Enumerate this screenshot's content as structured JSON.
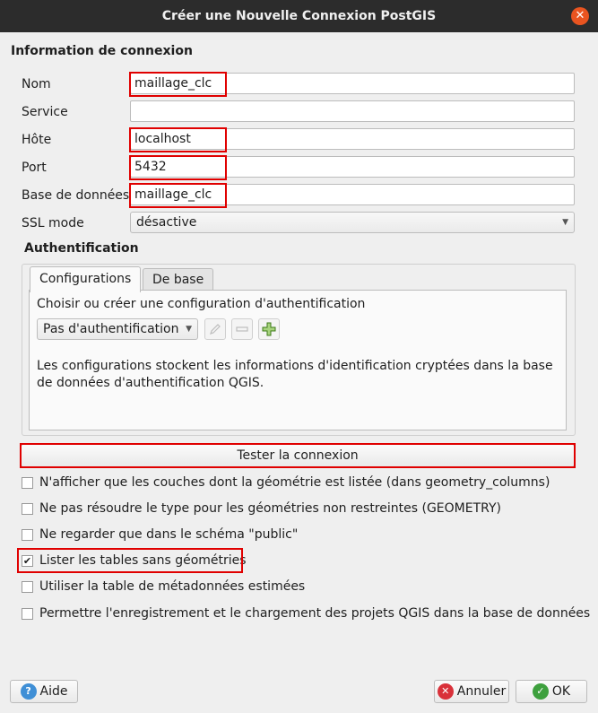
{
  "window": {
    "title": "Créer une Nouvelle Connexion PostGIS"
  },
  "connection_info": {
    "section_title": "Information de connexion",
    "fields": {
      "name": {
        "label": "Nom",
        "value": "maillage_clc"
      },
      "service": {
        "label": "Service",
        "value": ""
      },
      "host": {
        "label": "Hôte",
        "value": "localhost"
      },
      "port": {
        "label": "Port",
        "value": "5432"
      },
      "database": {
        "label": "Base de données",
        "value": "maillage_clc"
      },
      "ssl_mode": {
        "label": "SSL mode",
        "value": "désactive"
      }
    }
  },
  "authentication": {
    "section_title": "Authentification",
    "tabs": [
      {
        "label": "Configurations",
        "active": true
      },
      {
        "label": "De base",
        "active": false
      }
    ],
    "choose_label": "Choisir ou créer une configuration d'authentification",
    "config_combo": "Pas d'authentification",
    "info_text": "Les configurations stockent les informations d'identification cryptées dans la base de données d'authentification QGIS."
  },
  "test_button": "Tester la connexion",
  "options": [
    {
      "label": "N'afficher que les couches dont la géométrie est listée (dans geometry_columns)",
      "checked": false
    },
    {
      "label": "Ne pas résoudre le type pour les géométries non restreintes (GEOMETRY)",
      "checked": false
    },
    {
      "label": "Ne regarder que dans le schéma \"public\"",
      "checked": false
    },
    {
      "label": "Lister les tables sans géométries",
      "checked": true
    },
    {
      "label": "Utiliser la table de métadonnées estimées",
      "checked": false
    },
    {
      "label": "Permettre l'enregistrement et le chargement des projets QGIS dans la base de données",
      "checked": false
    }
  ],
  "buttons": {
    "help": "Aide",
    "cancel": "Annuler",
    "ok": "OK"
  },
  "icons": {
    "close": "close-icon",
    "help": "help-icon",
    "cancel": "cancel-icon",
    "ok": "ok-icon",
    "edit": "pencil-icon",
    "remove": "remove-icon",
    "add": "add-icon"
  },
  "colors": {
    "highlight": "#e00000",
    "accent": "#e95420"
  }
}
